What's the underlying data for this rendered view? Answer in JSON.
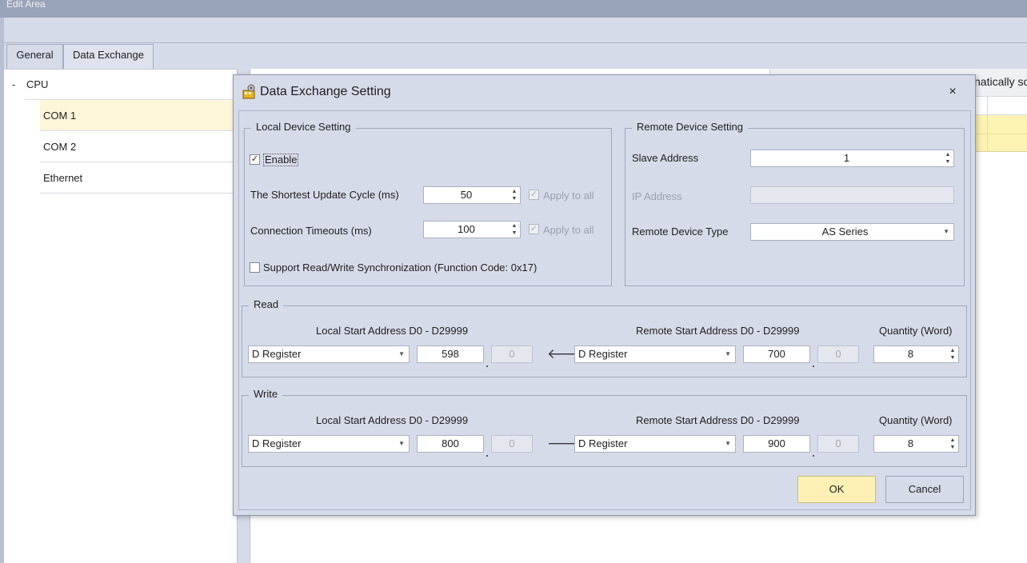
{
  "window": {
    "title": "Edit Area"
  },
  "tabs": [
    {
      "label": "General"
    },
    {
      "label": "Data Exchange"
    }
  ],
  "tree": {
    "root": {
      "expander": "-",
      "label": "CPU"
    },
    "items": [
      {
        "label": "COM 1",
        "selected": true
      },
      {
        "label": "COM 2",
        "selected": false
      },
      {
        "label": "Ethernet",
        "selected": false
      }
    ]
  },
  "background_grid": {
    "header_fragment": "natically so"
  },
  "dialog": {
    "title": "Data Exchange Setting",
    "icon": "gear-wrench-icon",
    "close_label": "×",
    "local": {
      "legend": "Local Device Setting",
      "enable": {
        "label": "Enable",
        "checked": true
      },
      "update_cycle": {
        "label": "The Shortest Update Cycle (ms)",
        "value": "50",
        "apply_label": "Apply to all",
        "apply_checked": true
      },
      "timeout": {
        "label": "Connection Timeouts (ms)",
        "value": "100",
        "apply_label": "Apply to all",
        "apply_checked": true
      },
      "sync": {
        "label": "Support Read/Write Synchronization (Function Code: 0x17)",
        "checked": false
      }
    },
    "remote": {
      "legend": "Remote Device Setting",
      "slave": {
        "label": "Slave Address",
        "value": "1"
      },
      "ip": {
        "label": "IP Address",
        "value": ""
      },
      "device_type": {
        "label": "Remote Device Type",
        "value": "AS Series"
      }
    },
    "read": {
      "legend": "Read",
      "local_header": "Local Start Address D0 - D29999",
      "remote_header": "Remote Start Address D0 - D29999",
      "qty_header": "Quantity (Word)",
      "local_type": "D Register",
      "local_addr": "598",
      "local_bit": "0",
      "direction": "🡐",
      "remote_type": "D Register",
      "remote_addr": "700",
      "remote_bit": "0",
      "quantity": "8"
    },
    "write": {
      "legend": "Write",
      "local_header": "Local Start Address D0 - D29999",
      "remote_header": "Remote Start Address D0 - D29999",
      "qty_header": "Quantity (Word)",
      "local_type": "D Register",
      "local_addr": "800",
      "local_bit": "0",
      "direction": "🡒",
      "remote_type": "D Register",
      "remote_addr": "900",
      "remote_bit": "0",
      "quantity": "8"
    },
    "buttons": {
      "ok": "OK",
      "cancel": "Cancel"
    },
    "colors": {
      "accent": "#fdf1b5",
      "selection": "#fdf6d8",
      "dialog_bg": "#d6dbe9"
    }
  }
}
